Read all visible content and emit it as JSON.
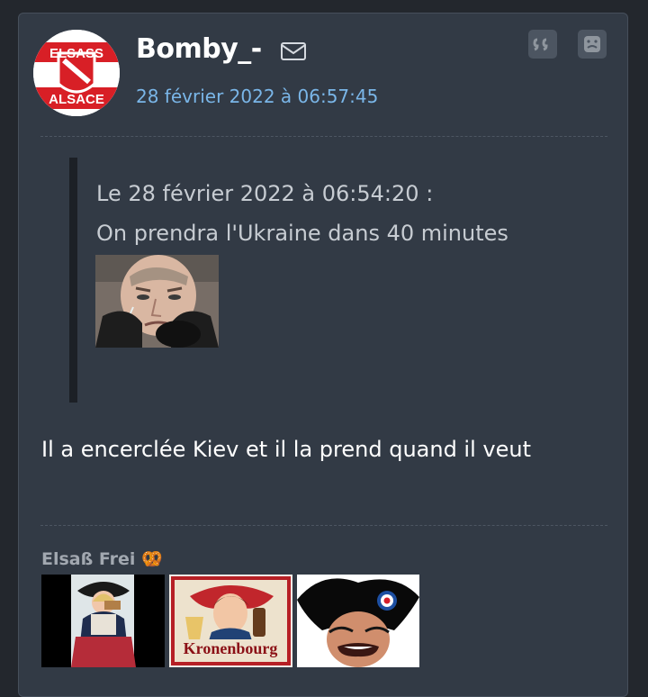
{
  "post": {
    "author": "Bomby_-",
    "date": "28 février 2022 à 06:57:45",
    "avatar_text_top": "ELSASS",
    "avatar_text_bottom": "ALSACE",
    "quote": {
      "header": "Le 28 février 2022 à 06:54:20 :",
      "text": "On prendra l'Ukraine dans 40 minutes",
      "image_alt": "crying man image"
    },
    "message": "Il a encerclée Kiev et il la prend quand il veut",
    "signature": {
      "title": "Elsaß Frei 🥨",
      "images": [
        {
          "alt": "alsatian girl eating"
        },
        {
          "alt": "Kronenbourg beer poster",
          "text": "Kronenbourg"
        },
        {
          "alt": "laughing man with bicorne hat"
        }
      ]
    }
  },
  "icons": {
    "mail": "mail-icon",
    "quote": "quote-icon",
    "report": "frown-face-icon"
  },
  "colors": {
    "background": "#23272d",
    "panel": "#323a45",
    "date": "#7ab6e8",
    "text": "#ffffff",
    "quote_text": "#c7ccd2"
  }
}
